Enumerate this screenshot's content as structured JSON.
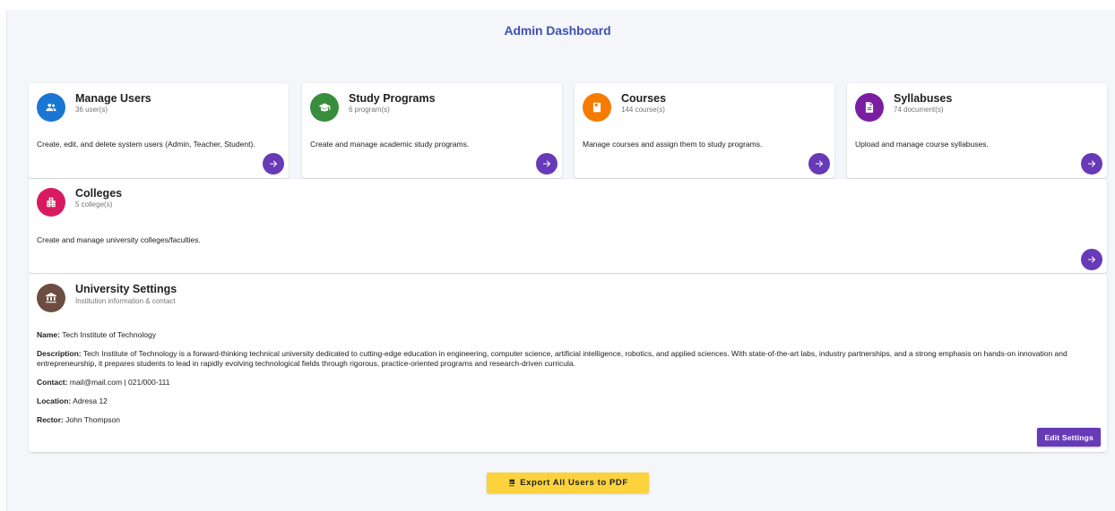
{
  "header": {
    "title": "Admin Dashboard"
  },
  "cards": {
    "users": {
      "title": "Manage Users",
      "subtitle": "36 user(s)",
      "description": "Create, edit, and delete system users (Admin, Teacher, Student).",
      "icon": "people-icon",
      "color": "#1976d2"
    },
    "programs": {
      "title": "Study Programs",
      "subtitle": "6 program(s)",
      "description": "Create and manage academic study programs.",
      "icon": "graduation-cap-icon",
      "color": "#388e3c"
    },
    "courses": {
      "title": "Courses",
      "subtitle": "144 course(s)",
      "description": "Manage courses and assign them to study programs.",
      "icon": "book-icon",
      "color": "#f57c00"
    },
    "syllabuses": {
      "title": "Syllabuses",
      "subtitle": "74 document(s)",
      "description": "Upload and manage course syllabuses.",
      "icon": "document-icon",
      "color": "#7b1fa2"
    },
    "colleges": {
      "title": "Colleges",
      "subtitle": "5 college(s)",
      "description": "Create and manage university colleges/faculties.",
      "icon": "building-icon",
      "color": "#d81b60"
    }
  },
  "settings": {
    "title": "University Settings",
    "subtitle": "Institution information & contact",
    "icon": "institution-icon",
    "color": "#6d4c41",
    "name_label": "Name:",
    "name": "Tech Institute of Technology",
    "description_label": "Description:",
    "description": "Tech Institute of Technology is a forward-thinking technical university dedicated to cutting-edge education in engineering, computer science, artificial intelligence, robotics, and applied sciences. With state-of-the-art labs, industry partnerships, and a strong emphasis on hands-on innovation and entrepreneurship, it prepares students to lead in rapidly evolving technological fields through rigorous, practice-oriented programs and research-driven curricula.",
    "contact_label": "Contact:",
    "contact": "mail@mail.com | 021/000-111",
    "location_label": "Location:",
    "location": "Adresa 12",
    "rector_label": "Rector:",
    "rector": "John Thompson",
    "edit_label": "Edit Settings"
  },
  "export": {
    "label": "Export All Users to PDF",
    "icon": "pdf-icon"
  },
  "colors": {
    "accent": "#673ab7",
    "title": "#3f51b5",
    "export": "#fcd23d"
  }
}
